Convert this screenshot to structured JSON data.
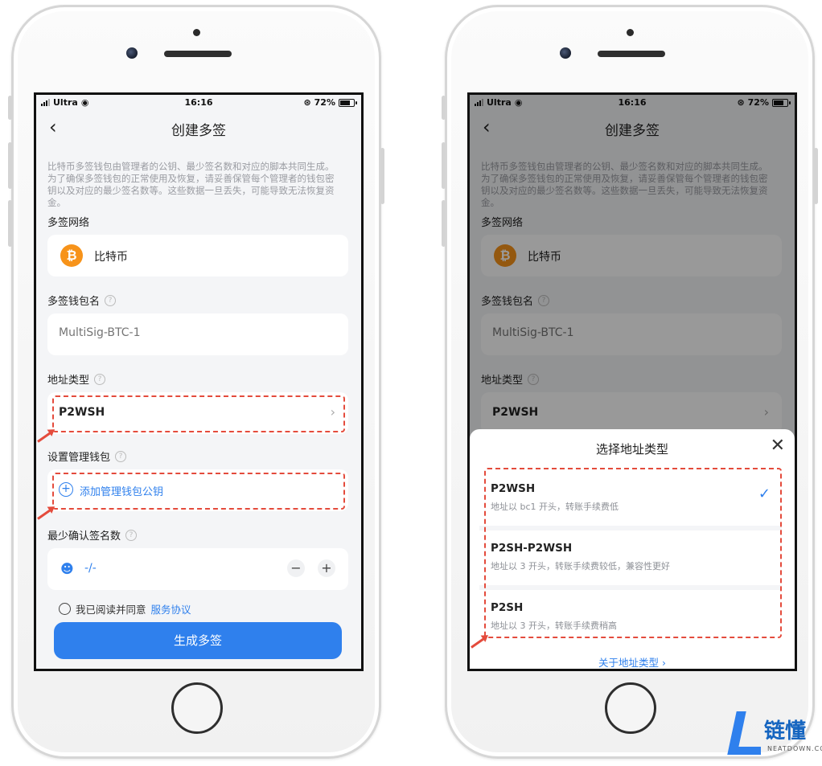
{
  "status_bar": {
    "carrier": "Ultra",
    "time": "16:16",
    "battery": "72%",
    "battery_level": 0.72
  },
  "nav": {
    "title": "创建多签"
  },
  "intro_text": "比特币多签钱包由管理者的公钥、最少签名数和对应的脚本共同生成。为了确保多签钱包的正常使用及恢复，请妥善保管每个管理者的钱包密钥以及对应的最少签名数等。这些数据一旦丢失，可能导致无法恢复资金。",
  "form": {
    "network_label": "多签网络",
    "network_value": "比特币",
    "wallet_name_label": "多签钱包名",
    "wallet_name_placeholder": "MultiSig-BTC-1",
    "address_type_label": "地址类型",
    "address_type_value": "P2WSH",
    "manager_label": "设置管理钱包",
    "add_manager": "添加管理钱包公钥",
    "min_sign_label": "最少确认签名数",
    "min_sign_value": "-/-",
    "agree_prefix": "我已阅读并同意",
    "agree_link": "服务协议",
    "submit": "生成多签"
  },
  "sheet": {
    "title": "选择地址类型",
    "options": [
      {
        "name": "P2WSH",
        "desc": "地址以 bc1 开头，转账手续费低",
        "selected": true
      },
      {
        "name": "P2SH-P2WSH",
        "desc": "地址以 3 开头，转账手续费较低，兼容性更好",
        "selected": false
      },
      {
        "name": "P2SH",
        "desc": "地址以 3 开头，转账手续费稍高",
        "selected": false
      }
    ],
    "about": "关于地址类型"
  },
  "watermark": {
    "cn": "链懂",
    "en": "NEATDOWN.COM"
  },
  "colors": {
    "accent": "#2f80ed",
    "bitcoin": "#f7931a",
    "highlight": "#e44b3c"
  }
}
